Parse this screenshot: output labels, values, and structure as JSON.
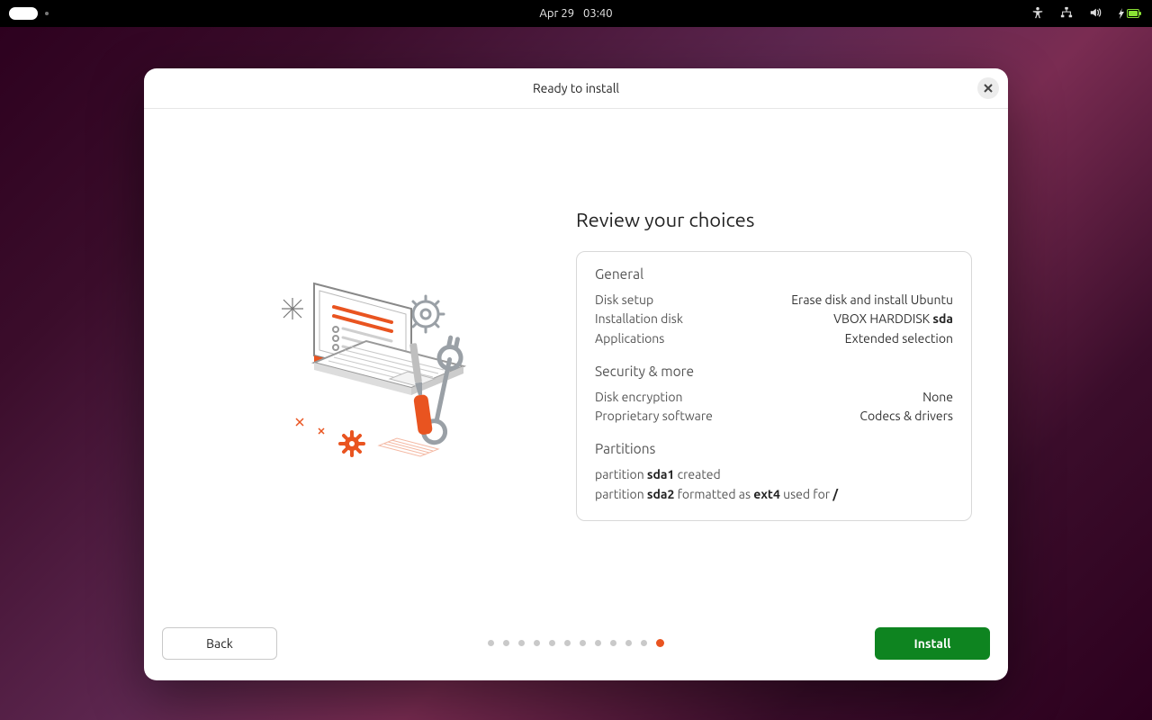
{
  "topbar": {
    "date": "Apr 29",
    "time": "03:40"
  },
  "window": {
    "title": "Ready to install",
    "heading": "Review your choices",
    "sections": {
      "general": {
        "title": "General",
        "disk_setup_label": "Disk setup",
        "disk_setup_value": "Erase disk and install Ubuntu",
        "install_disk_label": "Installation disk",
        "install_disk_value_prefix": "VBOX HARDDISK ",
        "install_disk_value_bold": "sda",
        "apps_label": "Applications",
        "apps_value": "Extended selection"
      },
      "security": {
        "title": "Security & more",
        "encryption_label": "Disk encryption",
        "encryption_value": "None",
        "proprietary_label": "Proprietary software",
        "proprietary_value": "Codecs & drivers"
      },
      "partitions": {
        "title": "Partitions",
        "p1_prefix": "partition ",
        "p1_bold": "sda1",
        "p1_suffix": " created",
        "p2_prefix": "partition ",
        "p2_bold1": "sda2",
        "p2_mid": " formatted as ",
        "p2_bold2": "ext4",
        "p2_mid2": " used for ",
        "p2_bold3": "/"
      }
    },
    "buttons": {
      "back": "Back",
      "install": "Install"
    },
    "step_count": 12,
    "active_step": 12
  }
}
